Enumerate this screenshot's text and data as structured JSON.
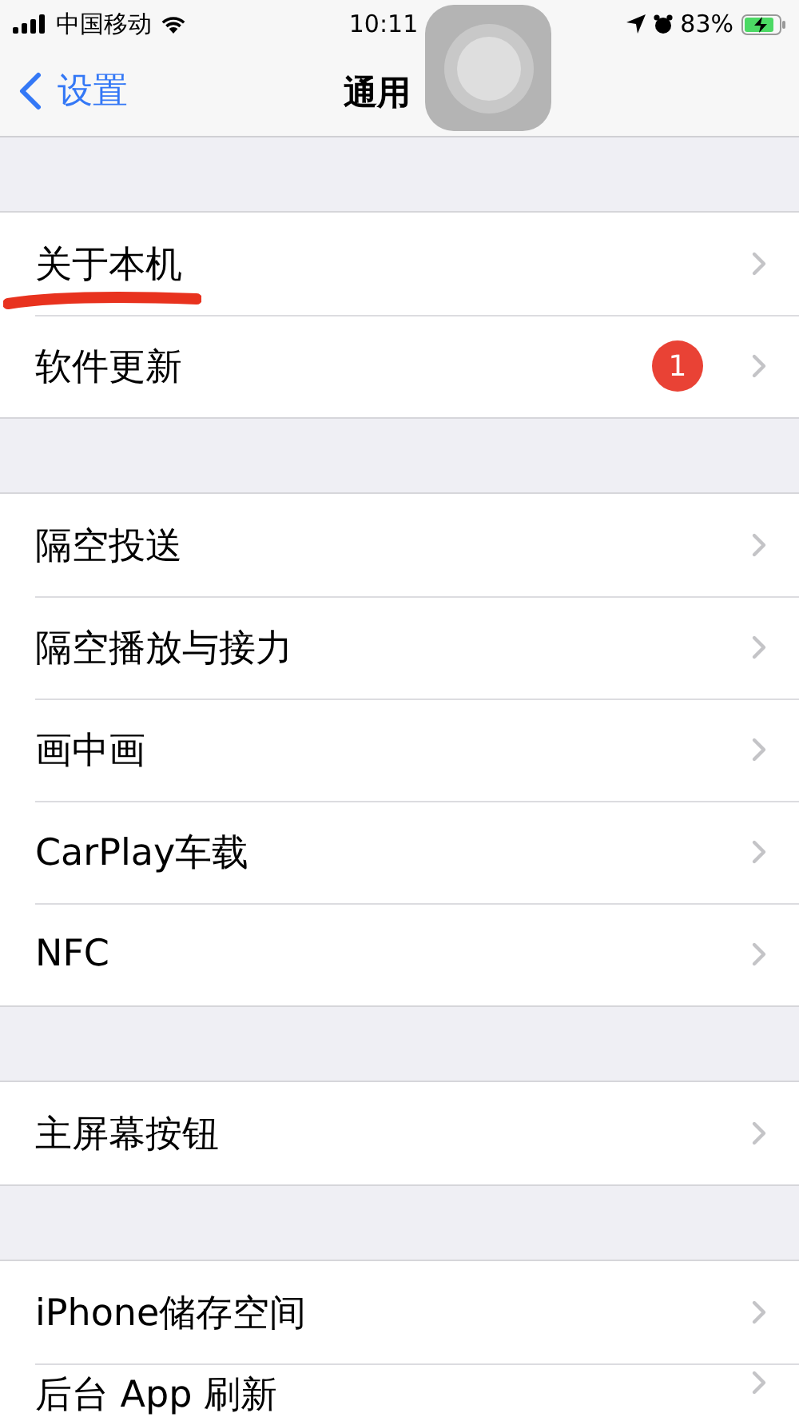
{
  "status_bar": {
    "carrier": "中国移动",
    "time": "10:11",
    "battery": "83%"
  },
  "nav": {
    "back": "设置",
    "title": "通用"
  },
  "groups": [
    {
      "rows": [
        {
          "label": "关于本机",
          "annotated": true
        },
        {
          "label": "软件更新",
          "badge": "1"
        }
      ]
    },
    {
      "rows": [
        {
          "label": "隔空投送"
        },
        {
          "label": "隔空播放与接力"
        },
        {
          "label": "画中画"
        },
        {
          "label": "CarPlay车载"
        },
        {
          "label": "NFC"
        }
      ]
    },
    {
      "rows": [
        {
          "label": "主屏幕按钮"
        }
      ]
    },
    {
      "rows": [
        {
          "label": "iPhone储存空间"
        },
        {
          "label": "后台 App 刷新"
        }
      ]
    }
  ]
}
